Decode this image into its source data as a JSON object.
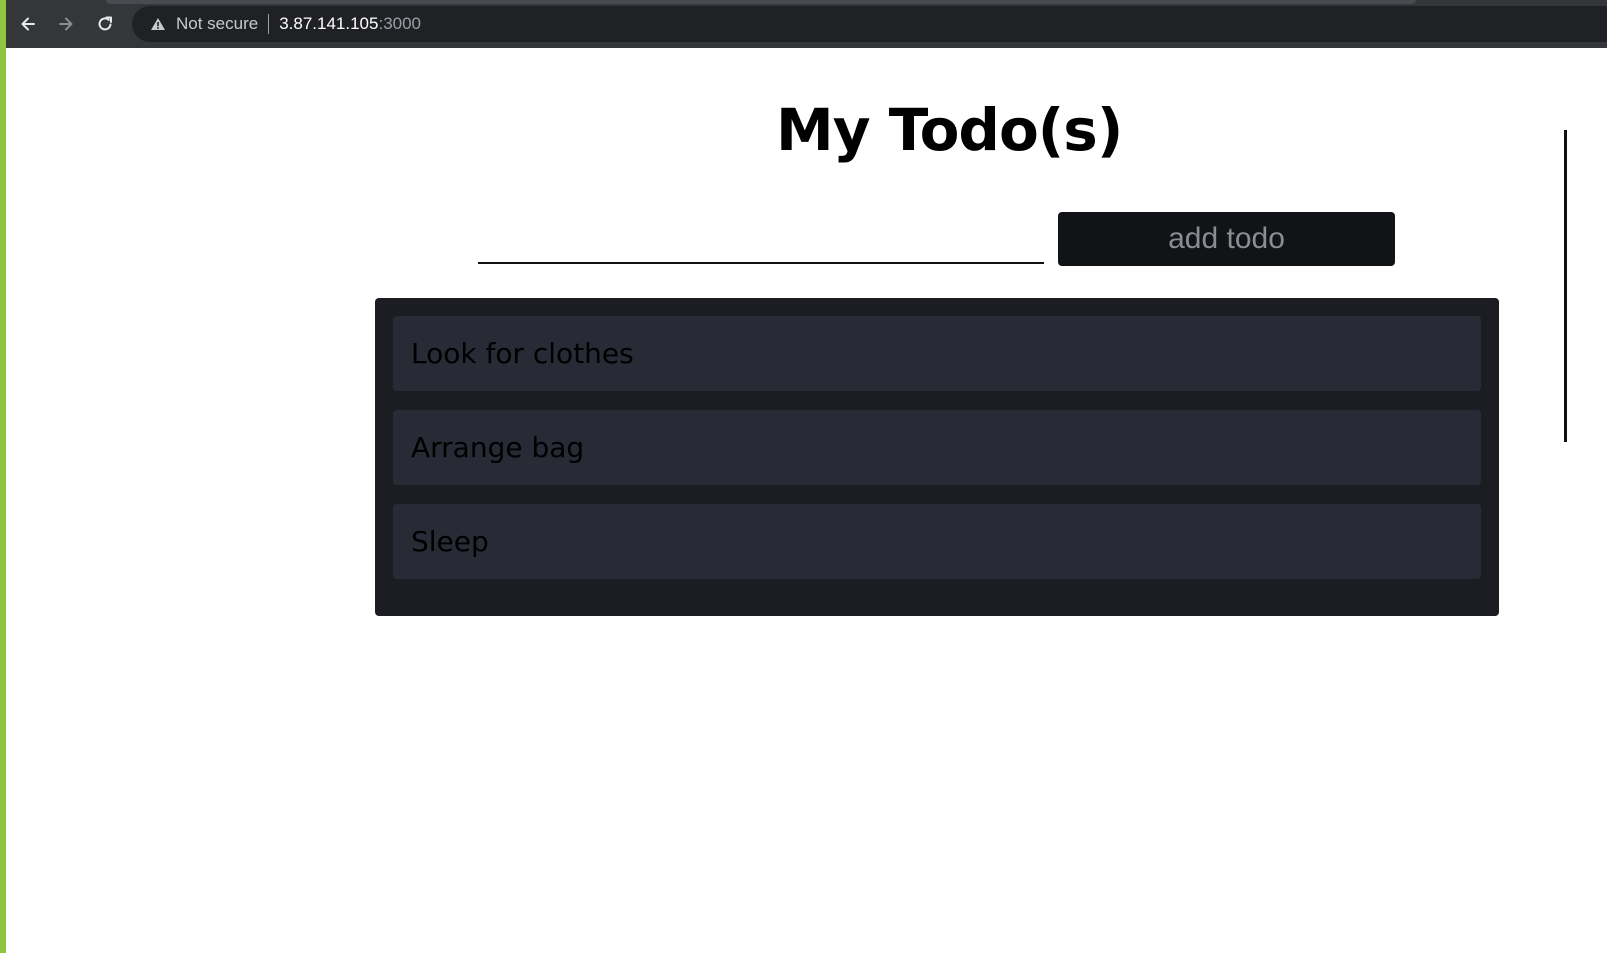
{
  "browser": {
    "security_label": "Not secure",
    "url_host": "3.87.141.105",
    "url_port": ":3000",
    "icons": [
      "back-arrow-icon",
      "forward-arrow-icon",
      "reload-icon",
      "warning-icon"
    ]
  },
  "app": {
    "title": "My Todo(s)",
    "input": {
      "value": "",
      "placeholder": ""
    },
    "add_button_label": "add todo",
    "todos": [
      {
        "text": "Look for clothes"
      },
      {
        "text": "Arrange bag"
      },
      {
        "text": "Sleep"
      }
    ]
  },
  "colors": {
    "accent_left_edge": "#8ec63f",
    "button_bg": "#111316",
    "list_bg": "#1b1d22",
    "item_bg": "#282b35"
  }
}
